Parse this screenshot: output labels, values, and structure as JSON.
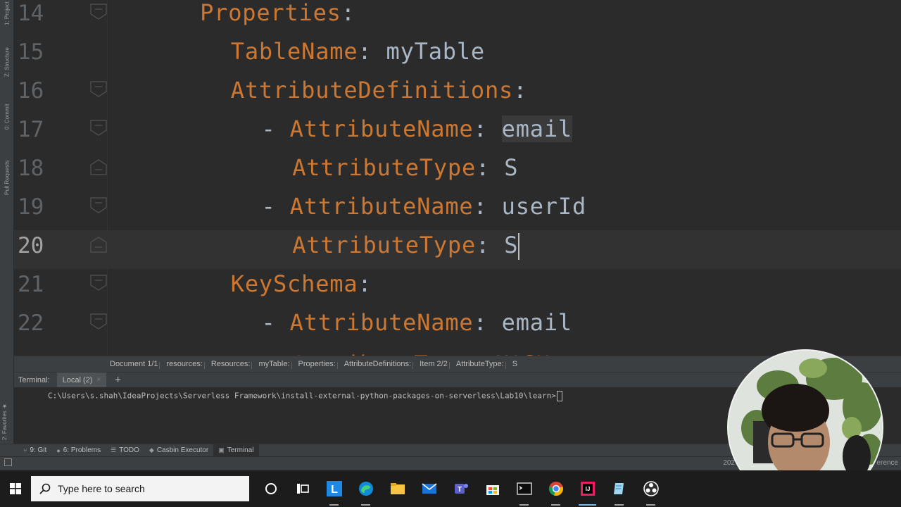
{
  "editor": {
    "lines": [
      {
        "num": "14",
        "indent": "      ",
        "key": "Properties",
        "sep": ":",
        "value": "",
        "dash": false,
        "fold": "open"
      },
      {
        "num": "15",
        "indent": "        ",
        "key": "TableName",
        "sep": ": ",
        "value": "myTable",
        "dash": false,
        "fold": "none"
      },
      {
        "num": "16",
        "indent": "        ",
        "key": "AttributeDefinitions",
        "sep": ":",
        "value": "",
        "dash": false,
        "fold": "open"
      },
      {
        "num": "17",
        "indent": "          ",
        "key": "AttributeName",
        "sep": ": ",
        "value": "email",
        "dash": true,
        "fold": "open",
        "highlight": true
      },
      {
        "num": "18",
        "indent": "            ",
        "key": "AttributeType",
        "sep": ": ",
        "value": "S",
        "dash": false,
        "fold": "close"
      },
      {
        "num": "19",
        "indent": "          ",
        "key": "AttributeName",
        "sep": ": ",
        "value": "userId",
        "dash": true,
        "fold": "open"
      },
      {
        "num": "20",
        "indent": "            ",
        "key": "AttributeType",
        "sep": ": ",
        "value": "S",
        "dash": false,
        "fold": "close",
        "current": true
      },
      {
        "num": "21",
        "indent": "        ",
        "key": "KeySchema",
        "sep": ":",
        "value": "",
        "dash": false,
        "fold": "open"
      },
      {
        "num": "22",
        "indent": "          ",
        "key": "AttributeName",
        "sep": ": ",
        "value": "email",
        "dash": true,
        "fold": "open"
      }
    ]
  },
  "breadcrumbs": [
    "Document 1/1",
    "resources:",
    "Resources:",
    "myTable:",
    "Properties:",
    "AttributeDefinitions:",
    "Item 2/2",
    "AttributeType:",
    "S"
  ],
  "left_tabs": {
    "project": "1: Project",
    "structure": "Z: Structure",
    "commit": "0: Commit",
    "pull_requests": "Pull Requests",
    "favorites": "2: Favorites"
  },
  "terminal": {
    "title": "Terminal:",
    "tab_label": "Local (2)",
    "close_glyph": "×",
    "add_glyph": "+",
    "prompt": "C:\\Users\\s.shah\\IdeaProjects\\Serverless Framework\\install-external-python-packages-on-serverless\\Lab10\\learn>"
  },
  "tool_windows": [
    {
      "label": "9: Git",
      "icon": "git-icon",
      "glyph": "⑂"
    },
    {
      "label": "6: Problems",
      "icon": "problems-icon",
      "glyph": "●"
    },
    {
      "label": "TODO",
      "icon": "todo-icon",
      "glyph": "☰"
    },
    {
      "label": "Casbin Executor",
      "icon": "casbin-icon",
      "glyph": "◆"
    },
    {
      "label": "Terminal",
      "icon": "terminal-icon",
      "glyph": "▣"
    }
  ],
  "status": {
    "right_partial": "erence",
    "date_partial": "202"
  },
  "taskbar": {
    "search_placeholder": "Type here to search",
    "apps": [
      "cortana-icon",
      "task-view-icon",
      "l-app-icon",
      "edge-icon",
      "file-explorer-icon",
      "mail-icon",
      "teams-icon",
      "store-icon",
      "cmd-icon",
      "chrome-icon",
      "intellij-icon",
      "notepad-icon",
      "obs-icon"
    ]
  },
  "colors": {
    "key": "#cc7832",
    "value": "#a9b7c6",
    "background": "#2b2b2b",
    "line_number": "#606366",
    "panel": "#3c3f41"
  }
}
